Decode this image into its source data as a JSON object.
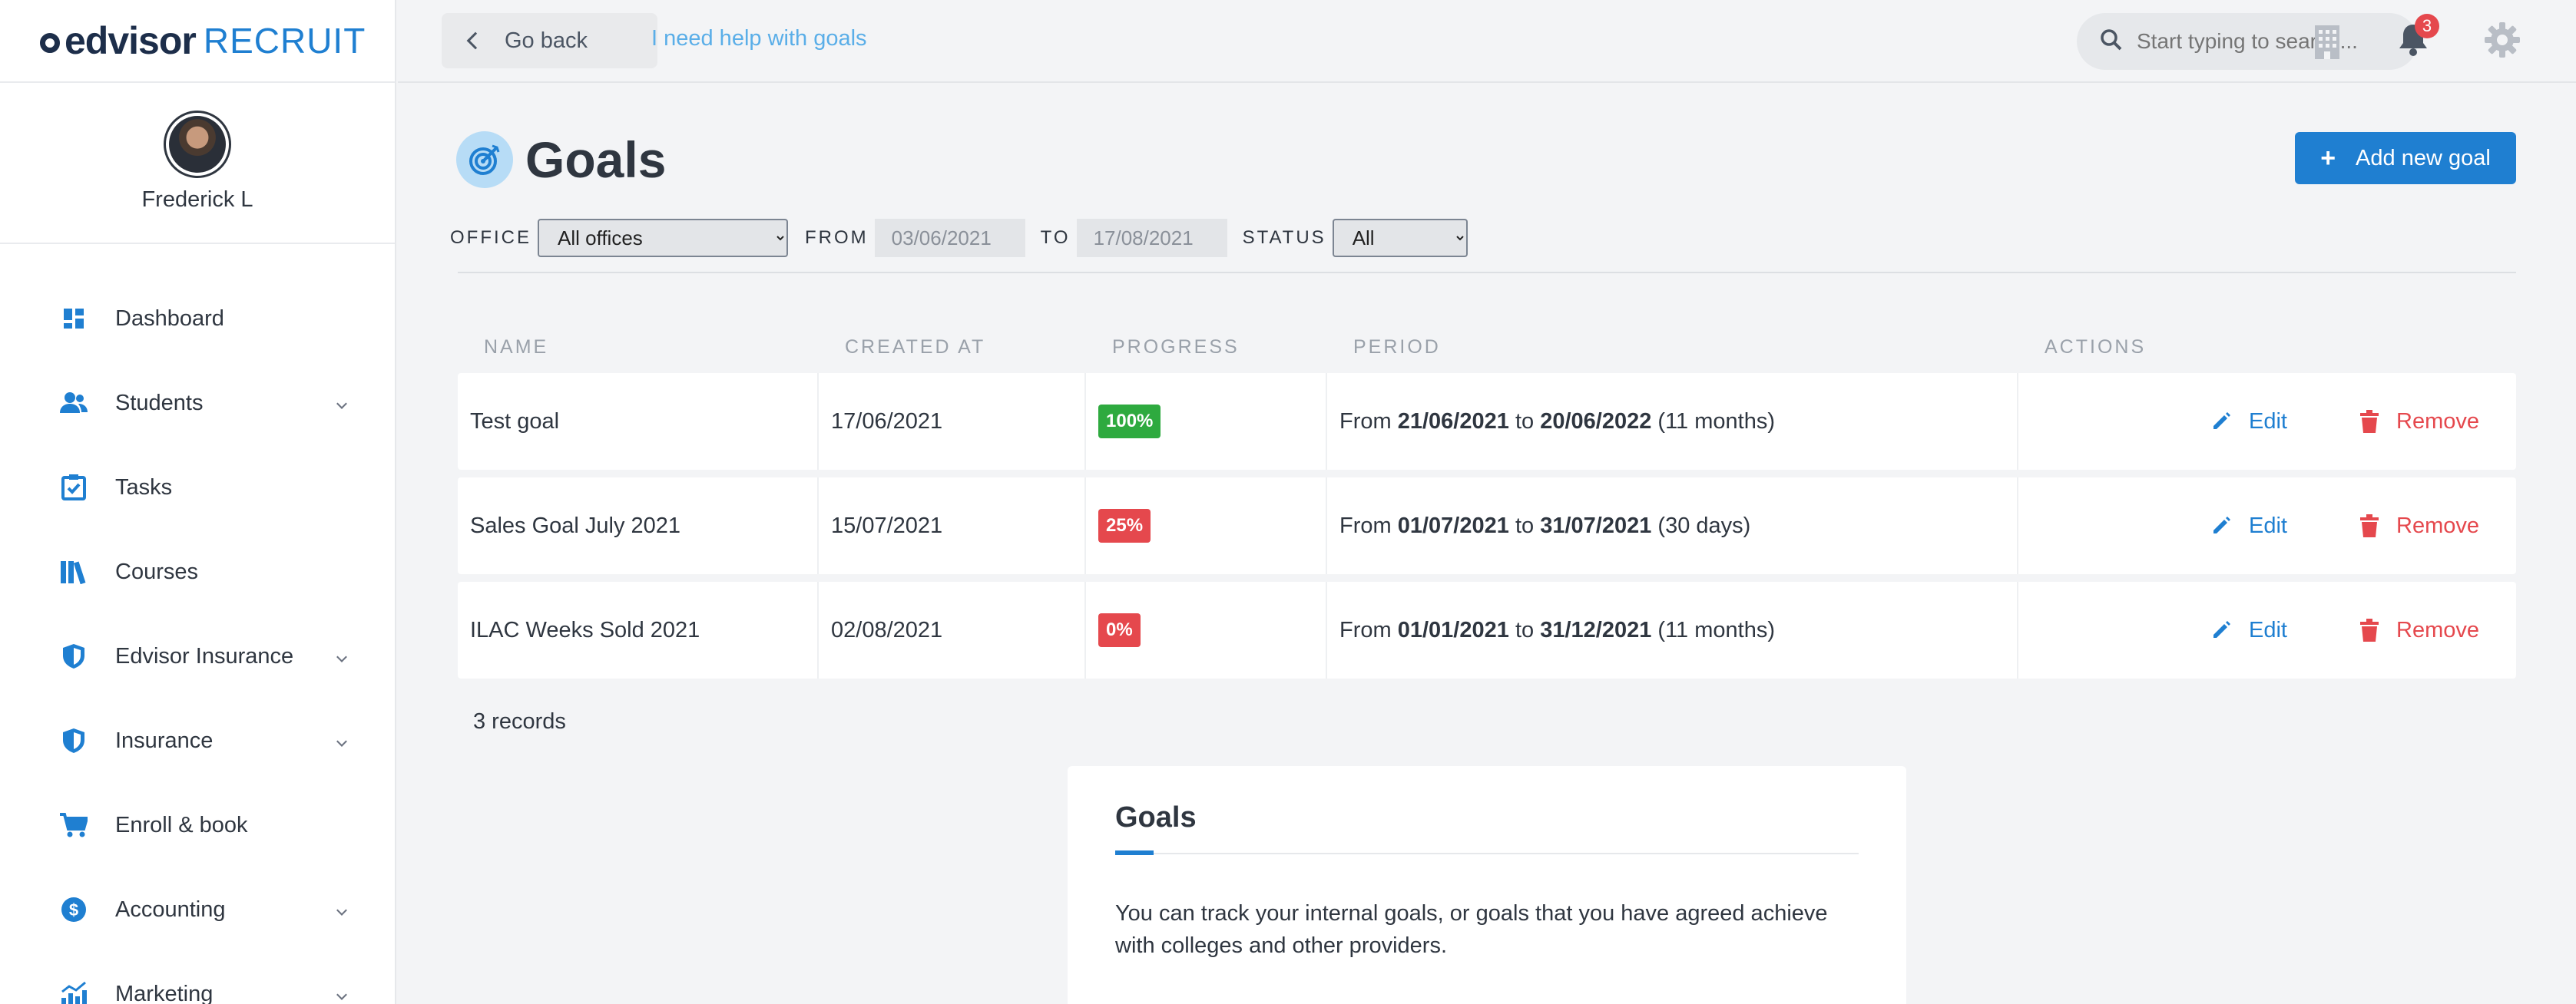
{
  "brand": {
    "name": "edvisor",
    "product": "RECRUIT"
  },
  "user": {
    "name": "Frederick L"
  },
  "sidebar": {
    "items": [
      {
        "label": "Dashboard",
        "icon": "dashboard-icon",
        "expandable": false
      },
      {
        "label": "Students",
        "icon": "users-icon",
        "expandable": true
      },
      {
        "label": "Tasks",
        "icon": "clipboard-check-icon",
        "expandable": false
      },
      {
        "label": "Courses",
        "icon": "books-icon",
        "expandable": false
      },
      {
        "label": "Edvisor Insurance",
        "icon": "shield-icon",
        "expandable": true
      },
      {
        "label": "Insurance",
        "icon": "shield-icon",
        "expandable": true
      },
      {
        "label": "Enroll & book",
        "icon": "cart-icon",
        "expandable": false
      },
      {
        "label": "Accounting",
        "icon": "dollar-icon",
        "expandable": true
      },
      {
        "label": "Marketing",
        "icon": "chart-icon",
        "expandable": true
      }
    ]
  },
  "topbar": {
    "back_label": "Go back",
    "help_link": "I need help with goals",
    "search_placeholder": "Start typing to search...",
    "notification_count": "3"
  },
  "page": {
    "title": "Goals",
    "add_button": "Add new goal"
  },
  "filters": {
    "office_label": "OFFICE",
    "office_value": "All offices",
    "from_label": "FROM",
    "from_value": "03/06/2021",
    "to_label": "TO",
    "to_value": "17/08/2021",
    "status_label": "STATUS",
    "status_value": "All"
  },
  "table": {
    "headers": {
      "name": "NAME",
      "created": "CREATED AT",
      "progress": "PROGRESS",
      "period": "PERIOD",
      "actions": "ACTIONS"
    },
    "rows": [
      {
        "name": "Test goal",
        "created": "17/06/2021",
        "progress": "100%",
        "progress_color": "#2eaa3f",
        "from_word": "From",
        "start": "21/06/2021",
        "to_word": "to",
        "end": "20/06/2022",
        "duration": "(11 months)"
      },
      {
        "name": "Sales Goal July 2021",
        "created": "15/07/2021",
        "progress": "25%",
        "progress_color": "#e5484d",
        "from_word": "From",
        "start": "01/07/2021",
        "to_word": "to",
        "end": "31/07/2021",
        "duration": "(30 days)"
      },
      {
        "name": "ILAC Weeks Sold 2021",
        "created": "02/08/2021",
        "progress": "0%",
        "progress_color": "#e5484d",
        "from_word": "From",
        "start": "01/01/2021",
        "to_word": "to",
        "end": "31/12/2021",
        "duration": "(11 months)"
      }
    ],
    "edit_label": "Edit",
    "remove_label": "Remove",
    "records": "3 records"
  },
  "help": {
    "title": "Goals",
    "text": "You can track your internal goals, or goals that you have agreed achieve with colleges and other providers."
  },
  "colors": {
    "accent": "#1f7fd1",
    "danger": "#e5484d",
    "success": "#2eaa3f"
  }
}
